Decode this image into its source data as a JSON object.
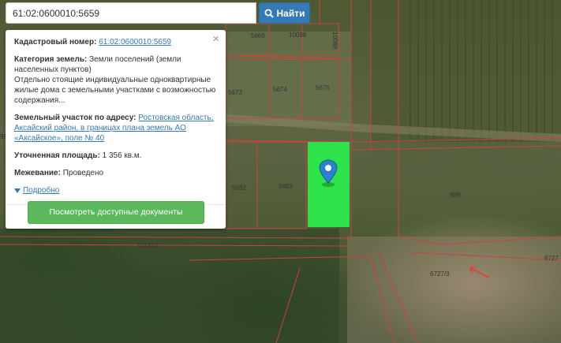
{
  "search": {
    "value": "61:02:0600010:5659",
    "button_label": "Найти"
  },
  "popup": {
    "cadastral_label": "Кадастровый номер:",
    "cadastral_value": "61:02:0600010:5659",
    "category_label": "Категория земель:",
    "category_value": "Земли поселений (земли населенных пунктов)",
    "usage_text": "Отдельно стоящие индивидуальные одноквартирные жилые дома с земельными участками с возможностью содержания...",
    "address_label": "Земельный участок по адресу:",
    "address_value": "Ростовская область, Аксайский район, в границах плана земель АО «Аксайское», поле № 40",
    "area_label": "Уточненная площадь:",
    "area_value": "1 356 кв.м.",
    "survey_label": "Межевание:",
    "survey_value": "Проведено",
    "more_label": "Подробно",
    "docs_button": "Посмотреть доступные документы",
    "close_symbol": "×"
  },
  "map": {
    "parcel_labels": [
      "5666",
      "10088",
      "10089",
      "5673",
      "5674",
      "5675",
      "5682",
      "5683",
      "989",
      "10331/1",
      "6727/3",
      "6727",
      "96"
    ],
    "highlight_color": "#2ee24a",
    "boundary_color": "#c8453c",
    "marker_icon": "map-pin-icon"
  }
}
